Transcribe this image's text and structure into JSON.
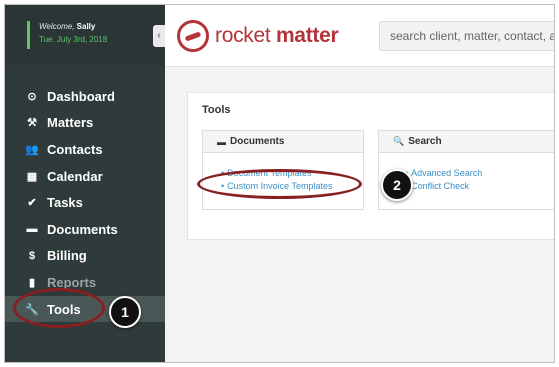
{
  "sidebar": {
    "welcome_prefix": "Welcome,",
    "user_name": "Sally",
    "date": "Tue. July 3rd, 2018",
    "collapse_glyph": "‹",
    "items": [
      {
        "label": "Dashboard",
        "icon": "⊙"
      },
      {
        "label": "Matters",
        "icon": "⚒"
      },
      {
        "label": "Contacts",
        "icon": "👥"
      },
      {
        "label": "Calendar",
        "icon": "▦"
      },
      {
        "label": "Tasks",
        "icon": "✔"
      },
      {
        "label": "Documents",
        "icon": "▬"
      },
      {
        "label": "Billing",
        "icon": "$"
      },
      {
        "label": "Reports",
        "icon": "▮"
      },
      {
        "label": "Tools",
        "icon": "🔧"
      }
    ]
  },
  "header": {
    "logo_light": "rocket",
    "logo_bold": "matter",
    "search_placeholder": "search client, matter, contact, act"
  },
  "main": {
    "title": "Tools",
    "documents_card": {
      "title": "Documents",
      "links": [
        "Document Templates",
        "Custom Invoice Templates"
      ]
    },
    "search_card": {
      "title": "Search",
      "links": [
        "Advanced Search",
        "Conflict Check"
      ]
    }
  },
  "annotations": {
    "step1": "1",
    "step2": "2"
  },
  "colors": {
    "brand": "#b3343b",
    "sidebar_bg": "#2f3a3a",
    "accent_green": "#5cc36e",
    "link": "#3a8fc7",
    "annotation_ring": "#8a1f22"
  }
}
